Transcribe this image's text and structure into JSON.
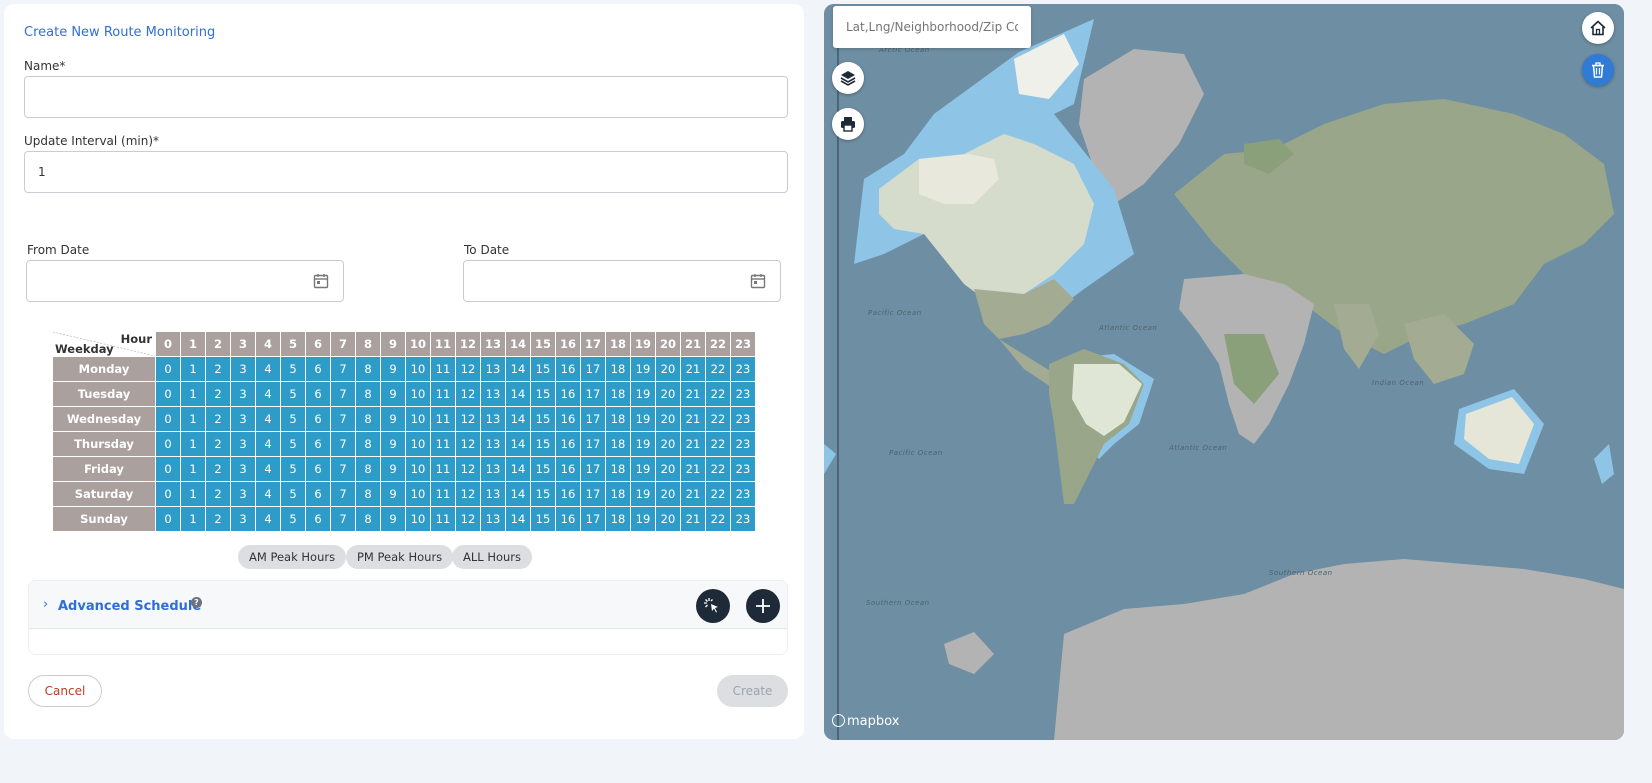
{
  "form": {
    "title": "Create New Route Monitoring",
    "name_label": "Name",
    "name_value": "",
    "interval_label": "Update Interval (min)",
    "interval_value": "1",
    "required_mark": "*",
    "from_date_label": "From Date",
    "to_date_label": "To Date"
  },
  "schedule": {
    "hour_header": "Hour",
    "weekday_header": "Weekday",
    "hours": [
      "0",
      "1",
      "2",
      "3",
      "4",
      "5",
      "6",
      "7",
      "8",
      "9",
      "10",
      "11",
      "12",
      "13",
      "14",
      "15",
      "16",
      "17",
      "18",
      "19",
      "20",
      "21",
      "22",
      "23"
    ],
    "days": [
      "Monday",
      "Tuesday",
      "Wednesday",
      "Thursday",
      "Friday",
      "Saturday",
      "Sunday"
    ],
    "cell_color": "#2e9cc8",
    "header_color": "#aaa09d"
  },
  "presets": {
    "am": "AM Peak Hours",
    "pm": "PM Peak Hours",
    "all": "ALL Hours"
  },
  "advanced": {
    "title": "Advanced Schedule",
    "help": "?"
  },
  "actions": {
    "cancel": "Cancel",
    "create": "Create"
  },
  "map": {
    "search_placeholder": "Lat,Lng/Neighborhood/Zip Cod",
    "attribution": "mapbox",
    "oceans": {
      "arctic": "Arctic Ocean",
      "pacific_n": "Pacific Ocean",
      "atlantic_n": "Atlantic Ocean",
      "pacific_s": "Pacific Ocean",
      "atlantic_s": "Atlantic Ocean",
      "indian": "Indian Ocean",
      "southern": "Southern Ocean",
      "southern_w": "Southern Ocean"
    }
  }
}
